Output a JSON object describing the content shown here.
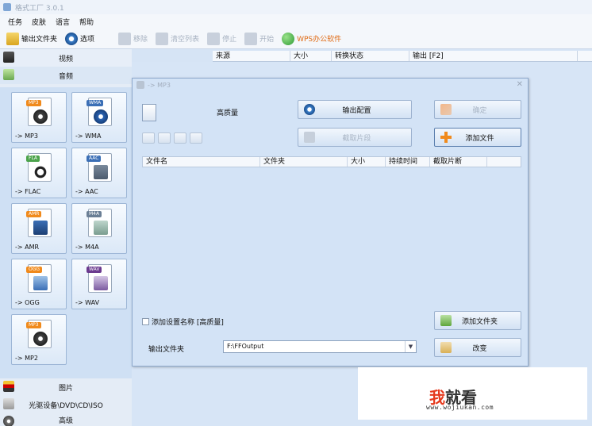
{
  "window": {
    "title": "格式工厂 3.0.1"
  },
  "menu": [
    "任务",
    "皮肤",
    "语言",
    "帮助"
  ],
  "toolbar": {
    "output_folder": "输出文件夹",
    "options": "选项",
    "remove": "移除",
    "clear_list": "清空列表",
    "stop": "停止",
    "start": "开始",
    "wps": "WPS办公软件"
  },
  "categories": {
    "video": "视频",
    "audio": "音频",
    "image": "图片",
    "disc": "光驱设备\\DVD\\CD\\ISO",
    "advanced": "高级"
  },
  "formats": [
    {
      "badge": "MP3",
      "label": "-> MP3",
      "color": "#f08a1c"
    },
    {
      "badge": "WMA",
      "label": "-> WMA",
      "color": "#3b6fb6"
    },
    {
      "badge": "FLA",
      "label": "-> FLAC",
      "color": "#4ba34b"
    },
    {
      "badge": "AAC",
      "label": "-> AAC",
      "color": "#3b6fb6"
    },
    {
      "badge": "AMR",
      "label": "-> AMR",
      "color": "#f08a1c"
    },
    {
      "badge": "M4A",
      "label": "-> M4A",
      "color": "#6b7f95"
    },
    {
      "badge": "OGG",
      "label": "-> OGG",
      "color": "#f08a1c"
    },
    {
      "badge": "WAV",
      "label": "-> WAV",
      "color": "#6b3a8f"
    },
    {
      "badge": "MP3",
      "label": "-> MP2",
      "color": "#f08a1c"
    }
  ],
  "main_table": {
    "columns": [
      "来源",
      "大小",
      "转换状态",
      "输出 [F2]"
    ]
  },
  "dialog": {
    "title": "-> MP3",
    "quality": "高质量",
    "output_config": "输出配置",
    "ok": "确定",
    "clip": "截取片段",
    "add_file": "添加文件",
    "columns": [
      "文件名",
      "文件夹",
      "大小",
      "持续时间",
      "截取片断"
    ],
    "add_setting_name": "添加设置名称 [高质量]",
    "add_folder": "添加文件夹",
    "output_folder_label": "输出文件夹",
    "output_path": "F:\\FFOutput",
    "change": "改变"
  },
  "watermark": {
    "brand_red": "我",
    "brand_dark": "就看",
    "url": "www.wojiukan.com"
  }
}
